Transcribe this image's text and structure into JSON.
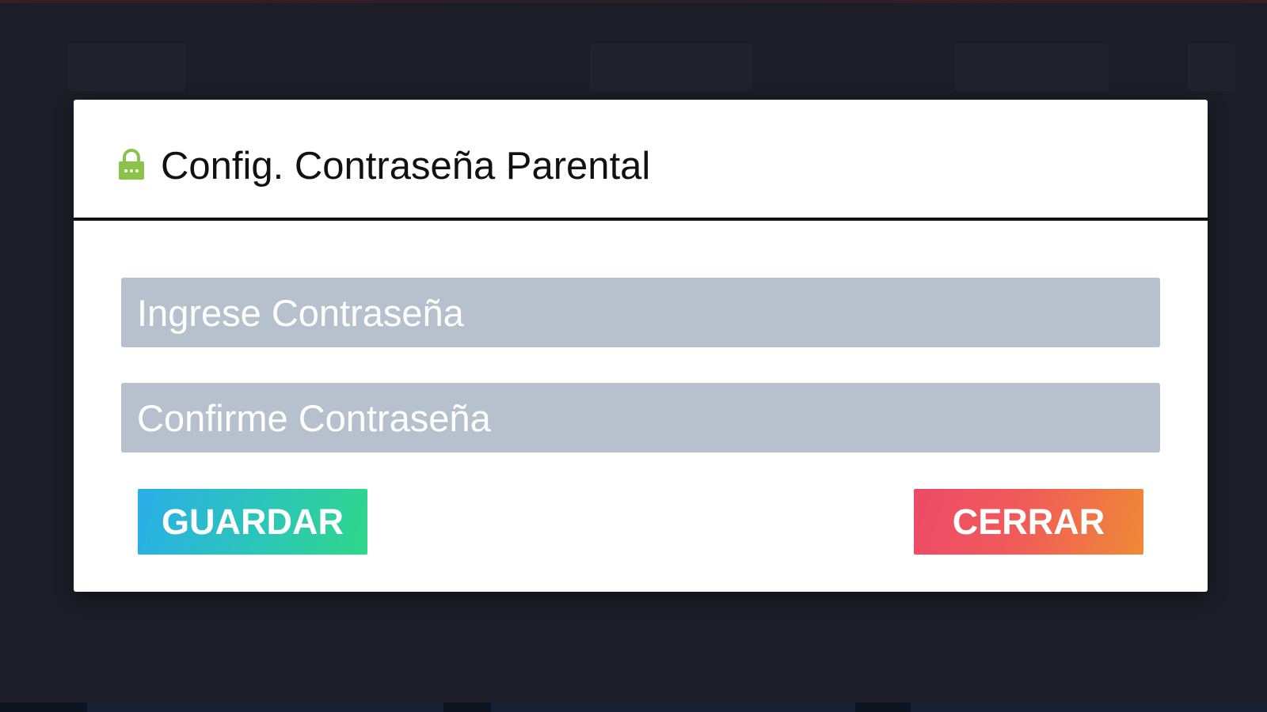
{
  "dialog": {
    "title": "Config. Contraseña Parental",
    "icon": "lock-icon",
    "icon_color": "#8bc34a"
  },
  "form": {
    "password_placeholder": "Ingrese Contraseña",
    "confirm_placeholder": "Confirme Contraseña",
    "password_value": "",
    "confirm_value": ""
  },
  "actions": {
    "save_label": "GUARDAR",
    "close_label": "CERRAR"
  },
  "colors": {
    "backdrop": "#1b1e27",
    "input_background": "#b7c1ce",
    "save_gradient": [
      "#2aaee8",
      "#2fd88a"
    ],
    "close_gradient": [
      "#ee4a68",
      "#ef8a36"
    ]
  }
}
